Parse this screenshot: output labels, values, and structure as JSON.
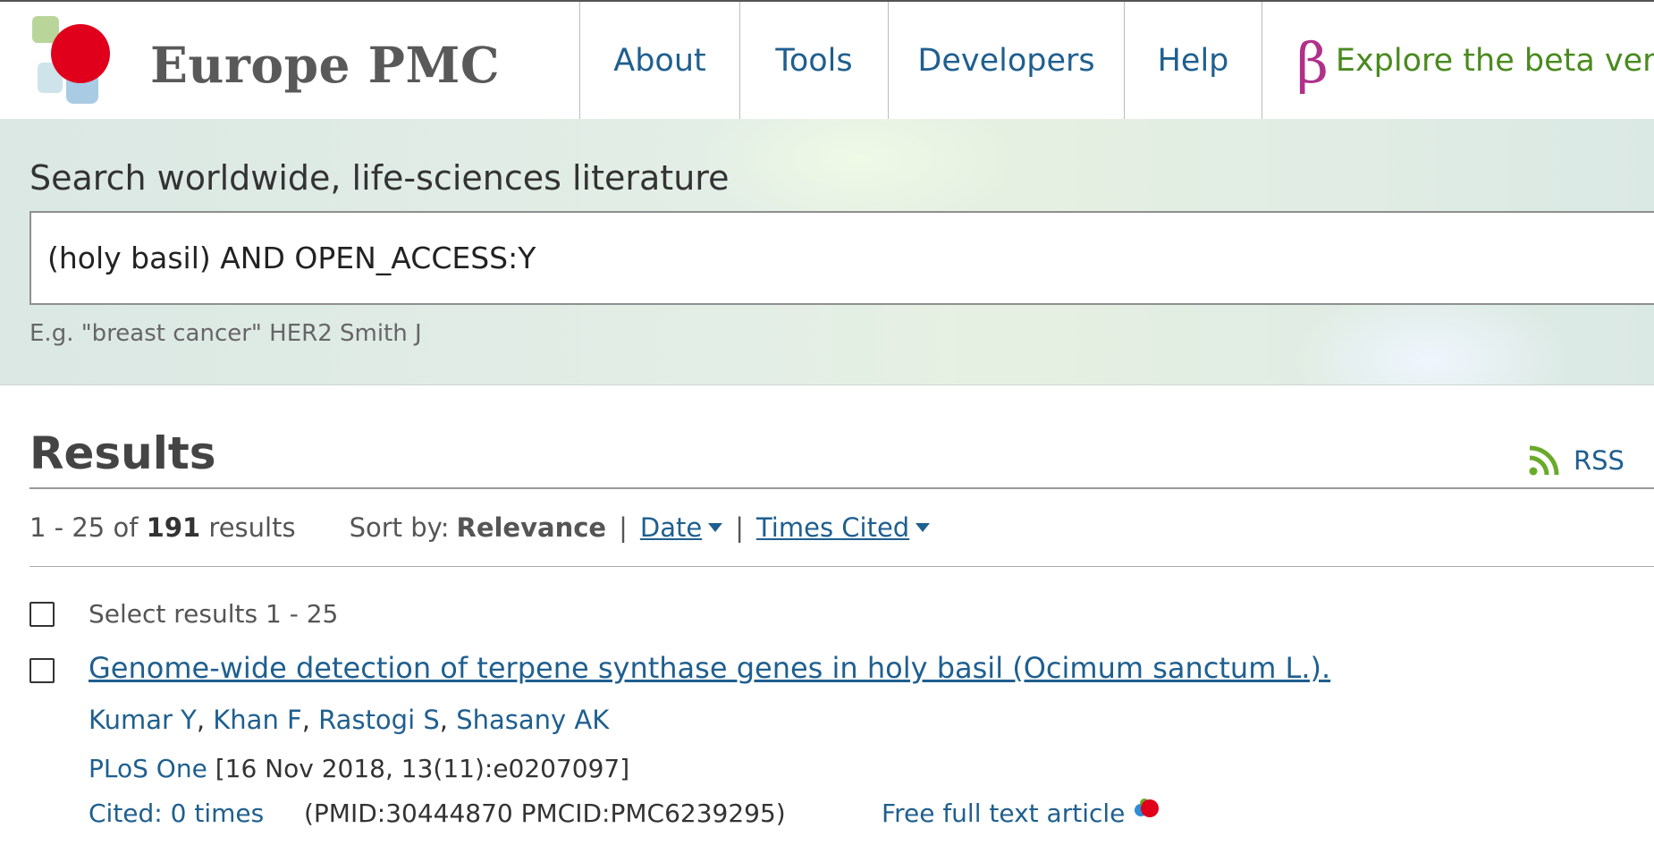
{
  "header": {
    "logo_text": "Europe PMC",
    "nav": {
      "about": "About",
      "tools": "Tools",
      "developers": "Developers",
      "help": "Help",
      "beta_symbol": "β",
      "beta": "Explore the beta vers"
    }
  },
  "search": {
    "heading": "Search worldwide, life-sciences literature",
    "query": "(holy basil) AND OPEN_ACCESS:Y",
    "example": "E.g. \"breast cancer\" HER2 Smith J"
  },
  "results": {
    "title": "Results",
    "rss_label": "RSS",
    "range": "1 - 25 of",
    "total": "191",
    "total_suffix": "results",
    "sort_by_label": "Sort by:",
    "sort_current": "Relevance",
    "sort_options": [
      "Date",
      "Times Cited"
    ],
    "select_label": "Select results 1 - 25",
    "items": [
      {
        "title": "Genome-wide detection of terpene synthase genes in holy basil (Ocimum sanctum L.).",
        "authors": [
          "Kumar Y",
          "Khan F",
          "Rastogi S",
          "Shasany AK"
        ],
        "journal": "PLoS One",
        "citation": "[16 Nov 2018, 13(11):e0207097]",
        "cited": "Cited: 0 times",
        "ids": "(PMID:30444870 PMCID:PMC6239295)",
        "free_full_text": "Free full text article"
      }
    ]
  },
  "colors": {
    "link": "#1f5f8f",
    "beta_text": "#4a8a1f",
    "beta_symbol": "#b0308a",
    "logo_red": "#e0001b",
    "rss_green": "#6aaa2a"
  }
}
